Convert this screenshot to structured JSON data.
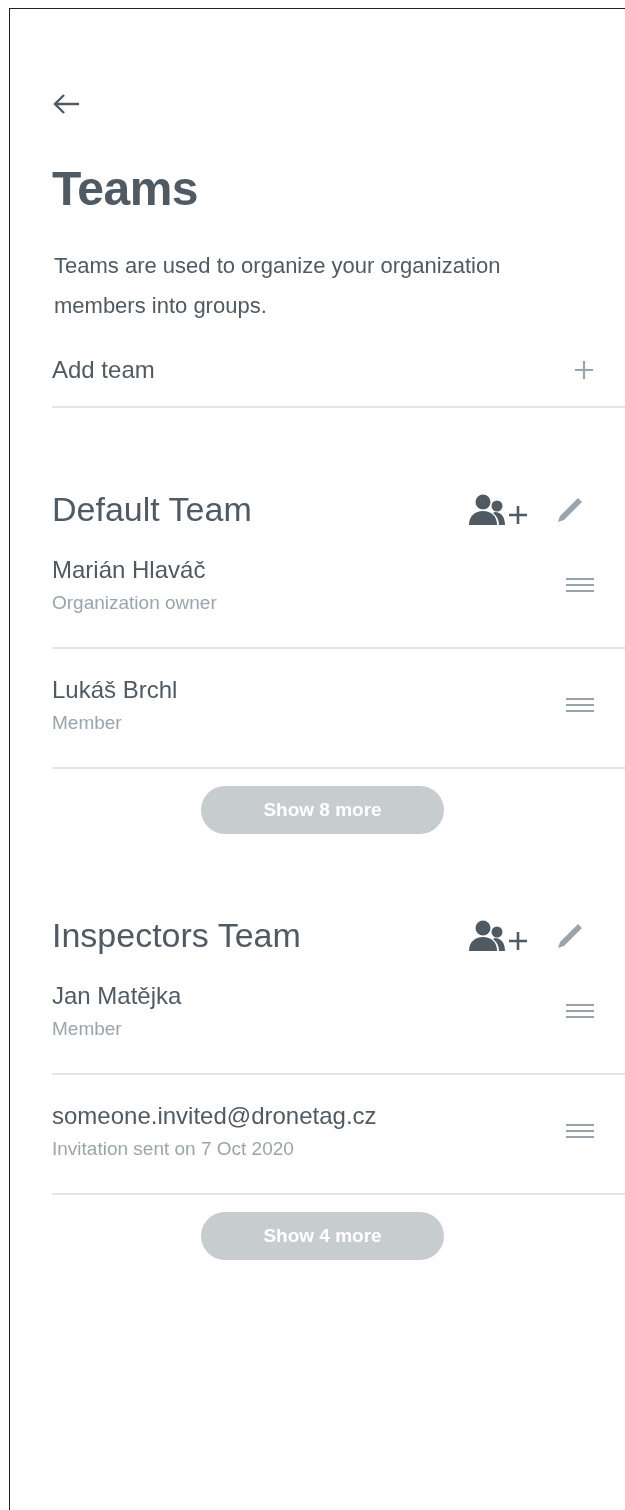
{
  "page": {
    "title": "Teams",
    "description": "Teams are used to organize your organization members into groups."
  },
  "add_team": {
    "label": "Add team"
  },
  "teams": [
    {
      "name": "Default Team",
      "members": [
        {
          "name": "Marián Hlaváč",
          "role": "Organization owner"
        },
        {
          "name": "Lukáš Brchl",
          "role": "Member"
        }
      ],
      "show_more": "Show 8 more"
    },
    {
      "name": "Inspectors Team",
      "members": [
        {
          "name": "Jan Matějka",
          "role": "Member"
        },
        {
          "name": "someone.invited@dronetag.cz",
          "role": "Invitation sent on 7 Oct 2020"
        }
      ],
      "show_more": "Show 4 more"
    }
  ]
}
